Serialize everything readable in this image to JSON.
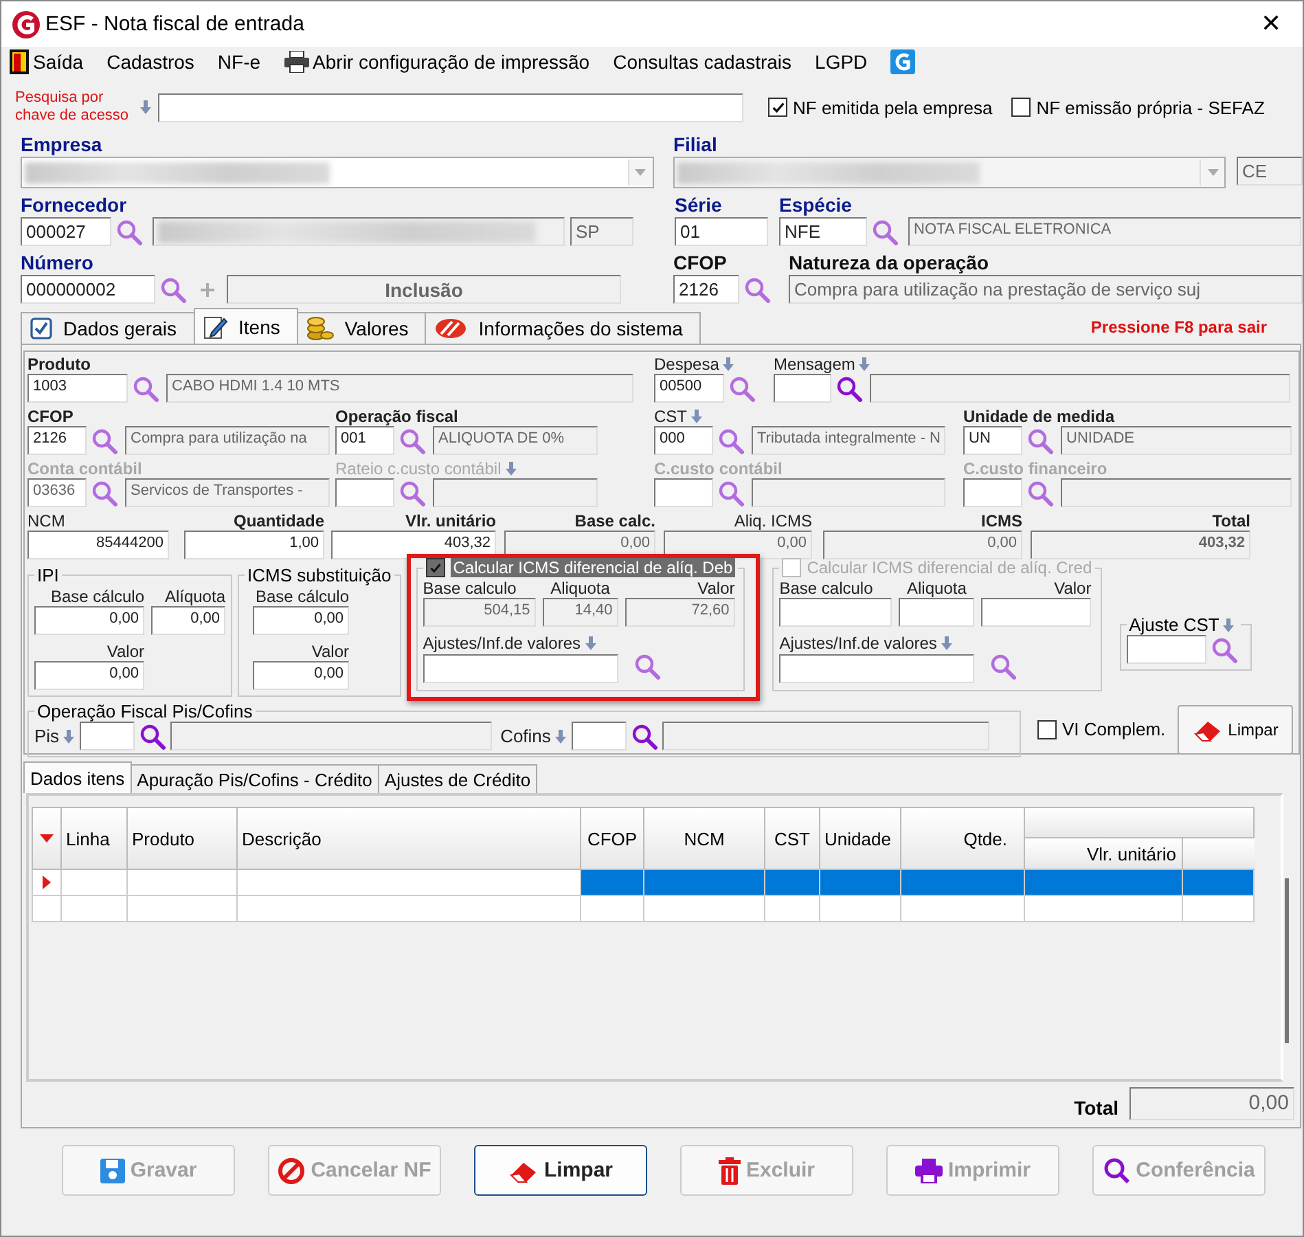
{
  "window": {
    "title": "ESF - Nota fiscal de entrada",
    "close": "✕"
  },
  "menu": [
    {
      "label": "Saída",
      "kind": "exit"
    },
    {
      "label": "Cadastros",
      "kind": "text"
    },
    {
      "label": "NF-e",
      "kind": "text"
    },
    {
      "label": "Abrir configuração de impressão",
      "kind": "print"
    },
    {
      "label": "Consultas cadastrais",
      "kind": "text"
    },
    {
      "label": "LGPD",
      "kind": "text"
    },
    {
      "kind": "logo"
    }
  ],
  "search": {
    "label": "Pesquisa por chave de acesso"
  },
  "flags": [
    {
      "label": "NF emitida pela empresa",
      "checked": true
    },
    {
      "label": "NF emissão própria - SEFAZ",
      "checked": false
    }
  ],
  "header": {
    "empresa": {
      "label": "Empresa"
    },
    "filial": {
      "label": "Filial",
      "uf": "CE"
    },
    "fornecedor": {
      "label": "Fornecedor",
      "code": "000027",
      "uf": "SP"
    },
    "serie": {
      "label": "Série",
      "value": "01"
    },
    "especie": {
      "label": "Espécie",
      "value": "NFE",
      "description": "NOTA FISCAL ELETRONICA"
    },
    "numero": {
      "label": "Número",
      "value": "000000002",
      "status": "Inclusão"
    },
    "cfop": {
      "label": "CFOP",
      "value": "2126"
    },
    "natureza": {
      "label": "Natureza da operação",
      "value": "Compra para utilização na prestação de serviço suj"
    }
  },
  "tabs": [
    {
      "label": "Dados gerais",
      "kind": "general",
      "selected": false
    },
    {
      "label": "Itens",
      "kind": "items",
      "selected": true
    },
    {
      "label": "Valores",
      "kind": "values",
      "selected": false
    },
    {
      "label": "Informações do sistema",
      "kind": "system",
      "selected": false
    }
  ],
  "exit_hint": "Pressione F8 para sair",
  "item": {
    "lookup_lines": [
      {
        "fields": [
          {
            "label": "Produto",
            "disabled": false,
            "code": "1003",
            "description": "CABO HDMI 1.4 10 MTS"
          },
          {
            "label": "Despesa",
            "disabled": false,
            "code": "00500"
          },
          {
            "label": "Mensagem",
            "disabled": false
          }
        ]
      },
      {
        "fields": [
          {
            "label": "CFOP",
            "disabled": false,
            "code": "2126",
            "description": "Compra para utilização na"
          },
          {
            "label": "Operação fiscal",
            "disabled": false,
            "code": "001",
            "description": "ALIQUOTA DE 0%"
          },
          {
            "label": "CST",
            "disabled": false,
            "code": "000",
            "description": "Tributada integralmente - N"
          },
          {
            "label": "Unidade de medida",
            "disabled": false,
            "code": "UN",
            "description": "UNIDADE"
          }
        ]
      },
      {
        "fields": [
          {
            "label": "Conta contábil",
            "disabled": true,
            "code": "03636",
            "description": "Servicos de Transportes -"
          },
          {
            "label": "Rateio c.custo contábil",
            "disabled": true
          },
          {
            "label": "C.custo contábil",
            "disabled": true
          },
          {
            "label": "C.custo financeiro",
            "disabled": true
          }
        ]
      }
    ],
    "values": [
      {
        "label": "NCM",
        "readonly": false,
        "value": "85444200"
      },
      {
        "label": "Quantidade",
        "readonly": false,
        "value": "1,00"
      },
      {
        "label": "Vlr. unitário",
        "readonly": false,
        "value": "403,32"
      },
      {
        "label": "Base calc.",
        "readonly": true,
        "value": "0,00"
      },
      {
        "label": "Aliq. ICMS",
        "readonly": true,
        "value": "0,00"
      },
      {
        "label": "ICMS",
        "readonly": true,
        "value": "0,00"
      },
      {
        "label": "Total",
        "readonly": true,
        "value": "403,32"
      }
    ],
    "ipi": {
      "title": "IPI",
      "fields": [
        {
          "label": "Base cálculo",
          "value": "0,00"
        },
        {
          "label": "Alíquota",
          "value": "0,00"
        },
        {
          "label": "Valor",
          "value": "0,00"
        }
      ]
    },
    "icms_st": {
      "title": "ICMS substituição",
      "fields": [
        {
          "label": "Base cálculo",
          "value": "0,00"
        },
        {
          "label": "Valor",
          "value": "0,00"
        }
      ]
    },
    "difal": [
      {
        "label": "Calcular ICMS diferencial de alíq. Deb",
        "checked": true,
        "disabled": false,
        "highlighted": true,
        "fields": [
          {
            "label": "Base calculo",
            "value": "504,15"
          },
          {
            "label": "Aliquota",
            "value": "14,40"
          },
          {
            "label": "Valor",
            "value": "72,60"
          }
        ],
        "ajustes_label": "Ajustes/Inf.de valores"
      },
      {
        "label": "Calcular ICMS diferencial de alíq. Cred",
        "checked": false,
        "disabled": true,
        "highlighted": false,
        "fields": [
          {
            "label": "Base calculo"
          },
          {
            "label": "Aliquota"
          },
          {
            "label": "Valor"
          }
        ],
        "ajustes_label": "Ajustes/Inf.de valores"
      }
    ],
    "ajuste_cst": {
      "title": "Ajuste CST"
    },
    "pis_cofins": {
      "title": "Operação Fiscal Pis/Cofins",
      "fields": [
        {
          "label": "Pis"
        },
        {
          "label": "Cofins"
        }
      ]
    },
    "vl_complem": {
      "label": "VI Complem.",
      "checked": false
    },
    "clear_button": {
      "label": "Limpar"
    }
  },
  "subtabs": [
    {
      "label": "Dados itens",
      "selected": true
    },
    {
      "label": "Apuração Pis/Cofins - Crédito",
      "selected": false
    },
    {
      "label": "Ajustes de Crédito",
      "selected": false
    }
  ],
  "grid": {
    "columns": [
      "Linha",
      "Produto",
      "Descrição",
      "CFOP",
      "NCM",
      "CST",
      "Unidade",
      "Qtde.",
      "Vlr. unitário"
    ],
    "rows": [
      {
        "selected": true
      },
      {
        "selected": false
      }
    ]
  },
  "total": {
    "label": "Total",
    "value": "0,00"
  },
  "buttons": [
    {
      "label": "Gravar",
      "kind": "save",
      "disabled": true,
      "focused": false
    },
    {
      "label": "Cancelar NF",
      "kind": "cancel",
      "disabled": true,
      "focused": false
    },
    {
      "label": "Limpar",
      "kind": "clear",
      "disabled": false,
      "focused": true
    },
    {
      "label": "Excluir",
      "kind": "delete",
      "disabled": true,
      "focused": false
    },
    {
      "label": "Imprimir",
      "kind": "print",
      "disabled": true,
      "focused": false
    },
    {
      "label": "Conferência",
      "kind": "review",
      "disabled": true,
      "focused": false
    }
  ]
}
